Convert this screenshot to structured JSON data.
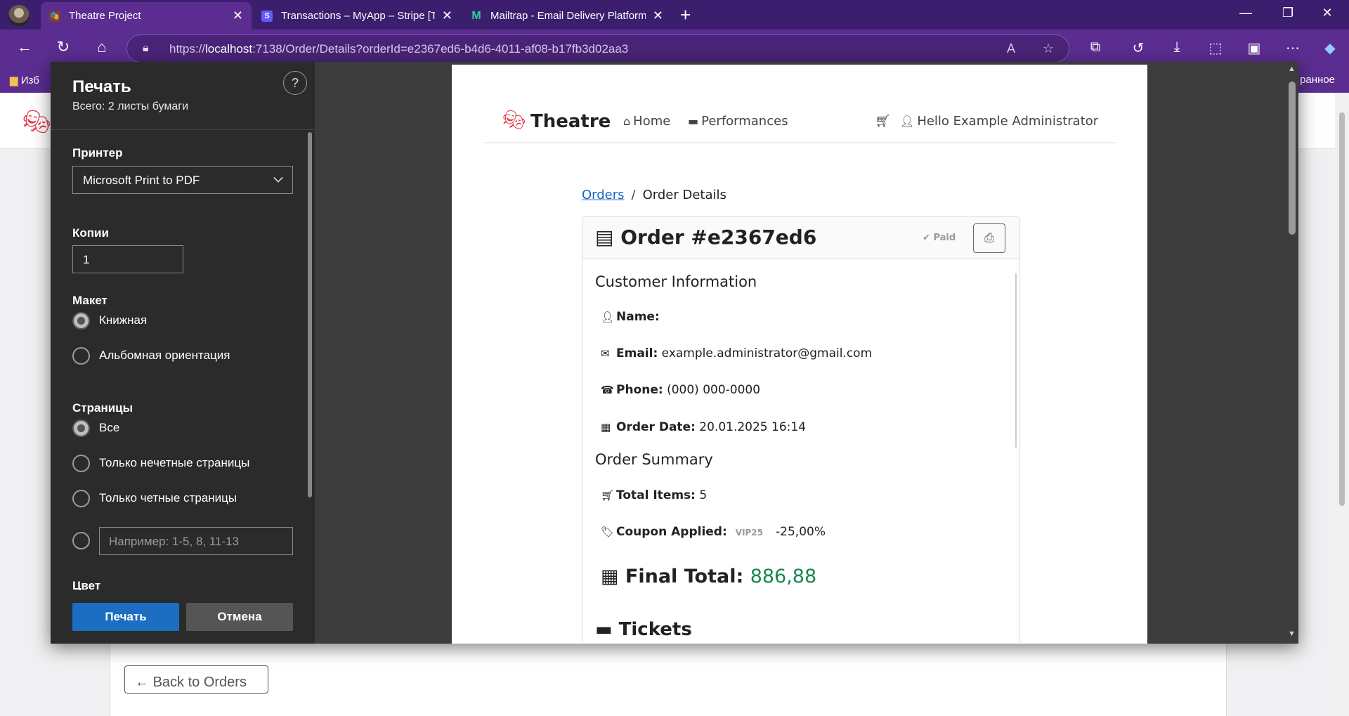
{
  "browser": {
    "tabs": [
      {
        "title": "Theatre Project",
        "active": true
      },
      {
        "title": "Transactions – MyApp – Stripe [Te",
        "active": false
      },
      {
        "title": "Mailtrap - Email Delivery Platform",
        "active": false
      }
    ],
    "url_prefix": "https://",
    "url_host": "localhost",
    "url_rest": ":7138/Order/Details?orderId=e2367ed6-b4d6-4011-af08-b17fb3d02aa3",
    "bookmarks_left": "Изб",
    "bookmarks_right": "ранное"
  },
  "print_dialog": {
    "title": "Печать",
    "subtitle": "Всего: 2 листы бумаги",
    "help": "?",
    "printer_label": "Принтер",
    "printer_value": "Microsoft Print to PDF",
    "copies_label": "Копии",
    "copies_value": "1",
    "layout_label": "Макет",
    "layout_options": [
      "Книжная",
      "Альбомная ориентация"
    ],
    "pages_label": "Страницы",
    "pages_options": [
      "Все",
      "Только нечетные страницы",
      "Только четные страницы"
    ],
    "pages_range_placeholder": "Например: 1-5, 8, 11-13",
    "color_label": "Цвет",
    "print_button": "Печать",
    "cancel_button": "Отмена"
  },
  "preview": {
    "brand": "Theatre",
    "nav_home": "Home",
    "nav_performances": "Performances",
    "nav_user": "Hello Example Administrator",
    "breadcrumb_link": "Orders",
    "breadcrumb_sep": "/",
    "breadcrumb_current": "Order Details",
    "order_title": "Order #e2367ed6",
    "status": "Paid",
    "customer_section": "Customer Information",
    "name_label": "Name:",
    "name_value": "",
    "email_label": "Email:",
    "email_value": "example.administrator@gmail.com",
    "phone_label": "Phone:",
    "phone_value": "(000) 000-0000",
    "date_label": "Order Date:",
    "date_value": "20.01.2025 16:14",
    "summary_section": "Order Summary",
    "items_label": "Total Items:",
    "items_value": "5",
    "coupon_label": "Coupon Applied:",
    "coupon_code": "VIP25",
    "coupon_value": "-25,00%",
    "final_label": "Final Total:",
    "final_value": "886,88",
    "tickets_section": "Tickets"
  },
  "page": {
    "back_button": "Back to Orders"
  }
}
